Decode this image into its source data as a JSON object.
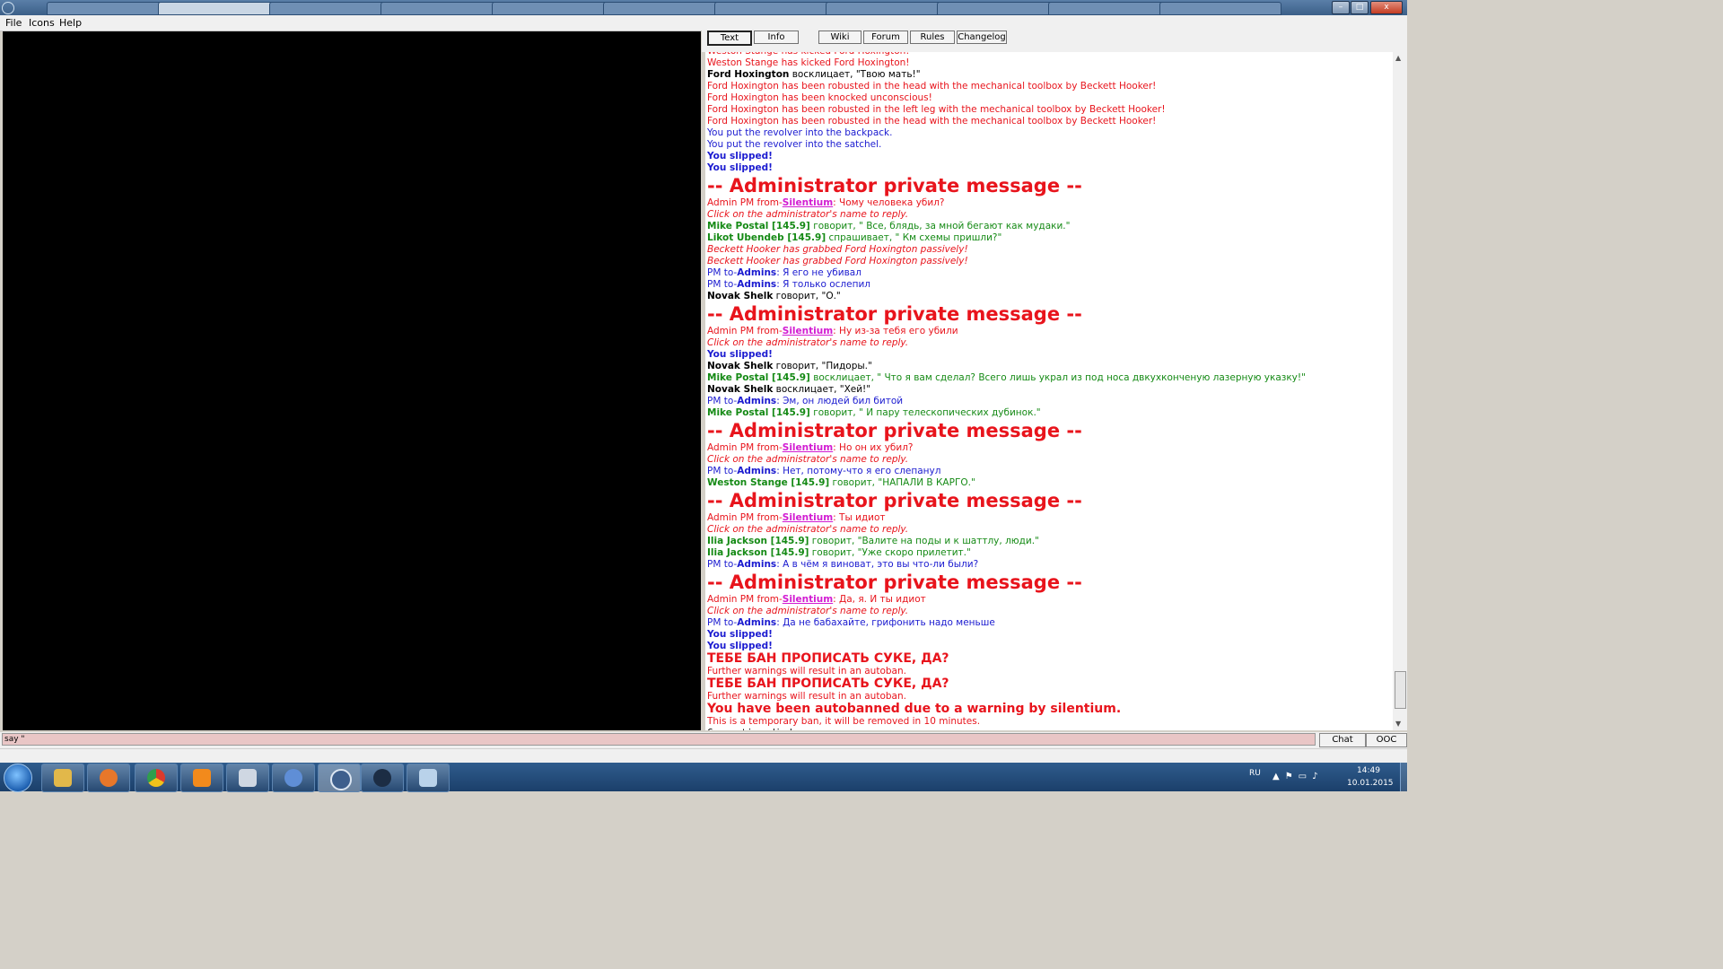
{
  "menu": {
    "file": "File",
    "icons": "Icons",
    "help": "Help"
  },
  "title_buttons": {
    "minimize": "–",
    "maximize": "□",
    "close": "x"
  },
  "top_buttons": [
    "Text",
    "Info",
    "Wiki",
    "Forum",
    "Rules",
    "Changelog"
  ],
  "input": {
    "value": "say \""
  },
  "mode_buttons": {
    "chat": "Chat",
    "ooc": "OOC"
  },
  "chat": [
    {
      "runs": [
        {
          "t": "Weston Stange has kicked Ford Hoxington!",
          "c": "red"
        }
      ]
    },
    {
      "runs": [
        {
          "t": "Weston Stange has kicked Ford Hoxington!",
          "c": "red"
        }
      ]
    },
    {
      "runs": [
        {
          "t": "Ford Hoxington",
          "c": "black bold"
        },
        {
          "t": " восклицает, \"Твою мать!\"",
          "c": "black"
        }
      ]
    },
    {
      "runs": [
        {
          "t": "Ford Hoxington has been robusted in the head with the mechanical toolbox by Beckett Hooker!",
          "c": "red"
        }
      ]
    },
    {
      "runs": [
        {
          "t": "Ford Hoxington has been knocked unconscious!",
          "c": "red"
        }
      ]
    },
    {
      "runs": [
        {
          "t": "Ford Hoxington has been robusted in the left leg with the mechanical toolbox by Beckett Hooker!",
          "c": "red"
        }
      ]
    },
    {
      "runs": [
        {
          "t": "Ford Hoxington has been robusted in the head with the mechanical toolbox by Beckett Hooker!",
          "c": "red"
        }
      ]
    },
    {
      "runs": [
        {
          "t": "You put the revolver into the backpack.",
          "c": "blue"
        }
      ]
    },
    {
      "runs": [
        {
          "t": "You put the revolver into the satchel.",
          "c": "blue"
        }
      ]
    },
    {
      "runs": [
        {
          "t": "You slipped!",
          "c": "blue bold"
        }
      ]
    },
    {
      "runs": [
        {
          "t": "You slipped!",
          "c": "blue bold"
        }
      ]
    },
    {
      "big": true,
      "runs": [
        {
          "t": "-- Administrator private message --",
          "c": "big"
        }
      ]
    },
    {
      "runs": [
        {
          "t": "Admin PM from-",
          "c": "red"
        },
        {
          "t": "Silentium",
          "c": "adminname"
        },
        {
          "t": ": Чому человека убил?",
          "c": "red"
        }
      ]
    },
    {
      "runs": [
        {
          "t": "Click on the administrator's name to reply.",
          "c": "red ital"
        }
      ]
    },
    {
      "runs": [
        {
          "t": "Mike Postal [145.9]",
          "c": "green bold"
        },
        {
          "t": " говорит, \" Все, блядь, за мной бегают как мудаки.\"",
          "c": "green"
        }
      ]
    },
    {
      "runs": [
        {
          "t": "Likot Ubendeb [145.9]",
          "c": "green bold"
        },
        {
          "t": " спрашивает, \" Км схемы пришли?\"",
          "c": "green"
        }
      ]
    },
    {
      "runs": [
        {
          "t": "Beckett Hooker has grabbed Ford Hoxington passively!",
          "c": "red ital"
        }
      ]
    },
    {
      "runs": [
        {
          "t": "Beckett Hooker has grabbed Ford Hoxington passively!",
          "c": "red ital"
        }
      ]
    },
    {
      "runs": [
        {
          "t": "PM to-",
          "c": "blue"
        },
        {
          "t": "Admins",
          "c": "blue bold"
        },
        {
          "t": ": Я его не убивал",
          "c": "blue"
        }
      ]
    },
    {
      "runs": [
        {
          "t": "PM to-",
          "c": "blue"
        },
        {
          "t": "Admins",
          "c": "blue bold"
        },
        {
          "t": ": Я только ослепил",
          "c": "blue"
        }
      ]
    },
    {
      "runs": [
        {
          "t": "Novak Shelk",
          "c": "black bold"
        },
        {
          "t": " говорит, \"О.\"",
          "c": "black"
        }
      ]
    },
    {
      "big": true,
      "runs": [
        {
          "t": "-- Administrator private message --",
          "c": "big"
        }
      ]
    },
    {
      "runs": [
        {
          "t": "Admin PM from-",
          "c": "red"
        },
        {
          "t": "Silentium",
          "c": "adminname"
        },
        {
          "t": ": Ну из-за тебя его убили",
          "c": "red"
        }
      ]
    },
    {
      "runs": [
        {
          "t": "Click on the administrator's name to reply.",
          "c": "red ital"
        }
      ]
    },
    {
      "runs": [
        {
          "t": "You slipped!",
          "c": "blue bold"
        }
      ]
    },
    {
      "runs": [
        {
          "t": "Novak Shelk",
          "c": "black bold"
        },
        {
          "t": " говорит, \"Пидоры.\"",
          "c": "black"
        }
      ]
    },
    {
      "runs": [
        {
          "t": "Mike Postal [145.9]",
          "c": "green bold"
        },
        {
          "t": " восклицает, \" Что я вам сделал? Всего лишь украл из под носа двкухконченую лазерную указку!\"",
          "c": "green"
        }
      ]
    },
    {
      "runs": [
        {
          "t": "Novak Shelk",
          "c": "black bold"
        },
        {
          "t": " восклицает, \"Хей!\"",
          "c": "black"
        }
      ]
    },
    {
      "runs": [
        {
          "t": "PM to-",
          "c": "blue"
        },
        {
          "t": "Admins",
          "c": "blue bold"
        },
        {
          "t": ": Эм, он людей бил битой",
          "c": "blue"
        }
      ]
    },
    {
      "runs": [
        {
          "t": "Mike Postal [145.9]",
          "c": "green bold"
        },
        {
          "t": " говорит, \" И пару телескопических дубинок.\"",
          "c": "green"
        }
      ]
    },
    {
      "big": true,
      "runs": [
        {
          "t": "-- Administrator private message --",
          "c": "big"
        }
      ]
    },
    {
      "runs": [
        {
          "t": "Admin PM from-",
          "c": "red"
        },
        {
          "t": "Silentium",
          "c": "adminname"
        },
        {
          "t": ": Но он их убил?",
          "c": "red"
        }
      ]
    },
    {
      "runs": [
        {
          "t": "Click on the administrator's name to reply.",
          "c": "red ital"
        }
      ]
    },
    {
      "runs": [
        {
          "t": "PM to-",
          "c": "blue"
        },
        {
          "t": "Admins",
          "c": "blue bold"
        },
        {
          "t": ": Нет, потому-что я его слепанул",
          "c": "blue"
        }
      ]
    },
    {
      "runs": [
        {
          "t": "Weston Stange [145.9]",
          "c": "green bold"
        },
        {
          "t": " говорит, \"НАПАЛИ В КАРГО.\"",
          "c": "green"
        }
      ]
    },
    {
      "big": true,
      "runs": [
        {
          "t": "-- Administrator private message --",
          "c": "big"
        }
      ]
    },
    {
      "runs": [
        {
          "t": "Admin PM from-",
          "c": "red"
        },
        {
          "t": "Silentium",
          "c": "adminname"
        },
        {
          "t": ": Ты идиот",
          "c": "red"
        }
      ]
    },
    {
      "runs": [
        {
          "t": "Click on the administrator's name to reply.",
          "c": "red ital"
        }
      ]
    },
    {
      "runs": [
        {
          "t": "Ilia Jackson [145.9]",
          "c": "green bold"
        },
        {
          "t": " говорит, \"Валите на поды и к шаттлу, люди.\"",
          "c": "green"
        }
      ]
    },
    {
      "runs": [
        {
          "t": "Ilia Jackson [145.9]",
          "c": "green bold"
        },
        {
          "t": " говорит, \"Уже скоро прилетит.\"",
          "c": "green"
        }
      ]
    },
    {
      "runs": [
        {
          "t": "PM to-",
          "c": "blue"
        },
        {
          "t": "Admins",
          "c": "blue bold"
        },
        {
          "t": ": А в чём я виноват, это вы что-ли были?",
          "c": "blue"
        }
      ]
    },
    {
      "big": true,
      "runs": [
        {
          "t": "-- Administrator private message --",
          "c": "big"
        }
      ]
    },
    {
      "runs": [
        {
          "t": "Admin PM from-",
          "c": "red"
        },
        {
          "t": "Silentium",
          "c": "adminname"
        },
        {
          "t": ": Да, я. И ты идиот",
          "c": "red"
        }
      ]
    },
    {
      "runs": [
        {
          "t": "Click on the administrator's name to reply.",
          "c": "red ital"
        }
      ]
    },
    {
      "runs": [
        {
          "t": "PM to-",
          "c": "blue"
        },
        {
          "t": "Admins",
          "c": "blue bold"
        },
        {
          "t": ": Да не бабахайте, грифонить надо меньше",
          "c": "blue"
        }
      ]
    },
    {
      "runs": [
        {
          "t": "You slipped!",
          "c": "blue bold"
        }
      ]
    },
    {
      "runs": [
        {
          "t": "You slipped!",
          "c": "blue bold"
        }
      ]
    },
    {
      "med": true,
      "runs": [
        {
          "t": "ТЕБЕ БАН ПРОПИСАТЬ СУКЕ, ДА?",
          "c": "med"
        }
      ]
    },
    {
      "runs": [
        {
          "t": "Further warnings will result in an autoban.",
          "c": "red"
        }
      ]
    },
    {
      "med": true,
      "runs": [
        {
          "t": "ТЕБЕ БАН ПРОПИСАТЬ СУКЕ, ДА?",
          "c": "med"
        }
      ]
    },
    {
      "runs": [
        {
          "t": "Further warnings will result in an autoban.",
          "c": "red"
        }
      ]
    },
    {
      "med": true,
      "runs": [
        {
          "t": "You have been autobanned due to a warning by silentium.",
          "c": "med"
        }
      ]
    },
    {
      "runs": [
        {
          "t": "This is a temporary ban, it will be removed in 10 minutes.",
          "c": "red"
        }
      ]
    },
    {
      "runs": [
        {
          "t": "Connection died.",
          "c": "black mono"
        }
      ]
    }
  ],
  "tray": {
    "language": "RU",
    "time": "14:49",
    "date": "10.01.2015"
  },
  "colors": {
    "red": "#e8141c",
    "blue": "#1b1bd0",
    "green": "#158a15",
    "admin": "#d21cd2"
  },
  "taskbar_apps": [
    "folder-icon",
    "media-player-icon",
    "chrome-icon",
    "sublime-icon",
    "calculator-icon",
    "utility-icon",
    "byond-icon",
    "steam-icon",
    "notepad-icon"
  ]
}
